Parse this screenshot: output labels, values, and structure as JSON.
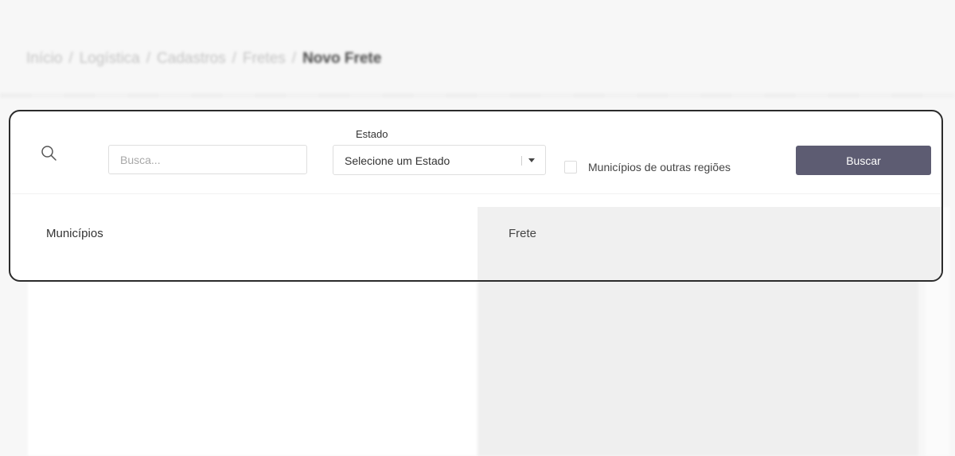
{
  "breadcrumb": {
    "items": [
      "Início",
      "Logística",
      "Cadastros",
      "Fretes"
    ],
    "current": "Novo Frete",
    "separator": "/"
  },
  "search": {
    "placeholder": "Busca...",
    "value": ""
  },
  "estado": {
    "label": "Estado",
    "selected": "Selecione um Estado"
  },
  "options": {
    "other_regions_label": "Municípios de outras regiões",
    "other_regions_checked": false
  },
  "actions": {
    "search_button_label": "Buscar"
  },
  "panels": {
    "municipios_title": "Municípios",
    "frete_title": "Frete"
  },
  "colors": {
    "button_bg": "#5d5c72",
    "card_border": "#2b2b2b",
    "frete_panel_bg": "#f0f0f0"
  },
  "icons": {
    "search": "search-icon",
    "caret": "chevron-down-icon"
  }
}
